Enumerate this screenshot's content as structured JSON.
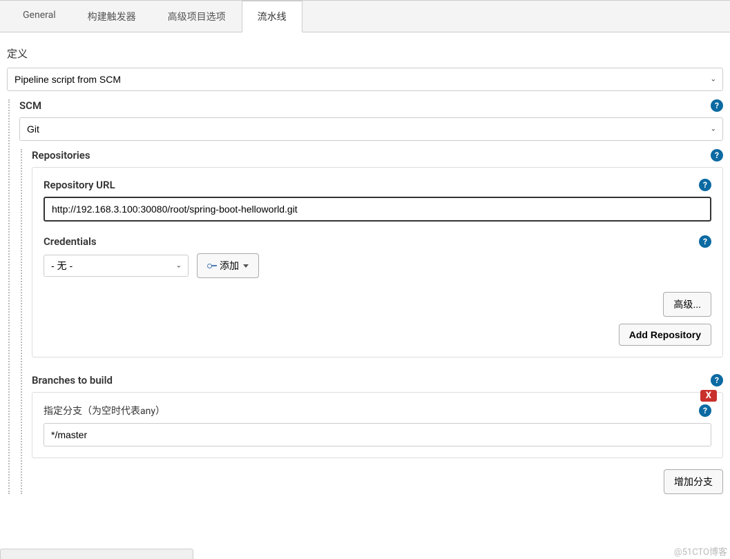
{
  "tabs": {
    "general": "General",
    "triggers": "构建触发器",
    "advanced": "高级项目选项",
    "pipeline": "流水线"
  },
  "definition_label": "定义",
  "definition_value": "Pipeline script from SCM",
  "scm": {
    "label": "SCM",
    "value": "Git"
  },
  "repositories": {
    "label": "Repositories",
    "url_label": "Repository URL",
    "url_value": "http://192.168.3.100:30080/root/spring-boot-helloworld.git",
    "credentials_label": "Credentials",
    "credentials_value": "- 无 -",
    "add_button": "添加",
    "advanced_button": "高级...",
    "add_repo_button": "Add Repository"
  },
  "branches": {
    "label": "Branches to build",
    "specifier_label": "指定分支（为空时代表any）",
    "specifier_value": "*/master",
    "delete_label": "X",
    "add_branch_button": "增加分支"
  },
  "watermark": "@51CTO博客",
  "help_q": "?"
}
